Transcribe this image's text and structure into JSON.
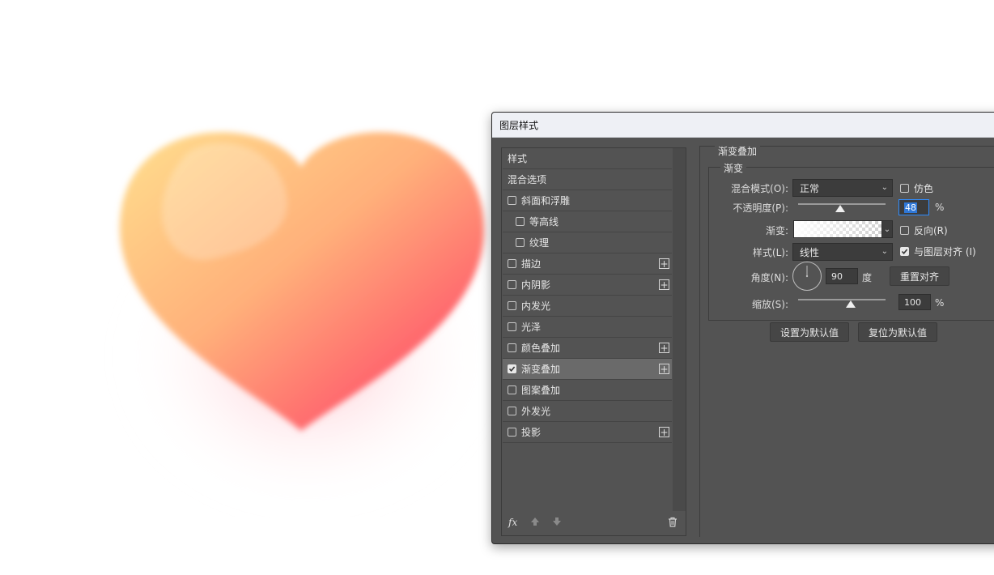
{
  "dialog": {
    "title": "图层样式"
  },
  "style_list": {
    "header_items": [
      {
        "label": "样式"
      },
      {
        "label": "混合选项"
      }
    ],
    "items": [
      {
        "label": "斜面和浮雕",
        "checked": false,
        "has_plus": false,
        "indent": false
      },
      {
        "label": "等高线",
        "checked": false,
        "has_plus": false,
        "indent": true
      },
      {
        "label": "纹理",
        "checked": false,
        "has_plus": false,
        "indent": true
      },
      {
        "label": "描边",
        "checked": false,
        "has_plus": true,
        "indent": false
      },
      {
        "label": "内阴影",
        "checked": false,
        "has_plus": true,
        "indent": false
      },
      {
        "label": "内发光",
        "checked": false,
        "has_plus": false,
        "indent": false
      },
      {
        "label": "光泽",
        "checked": false,
        "has_plus": false,
        "indent": false
      },
      {
        "label": "颜色叠加",
        "checked": false,
        "has_plus": true,
        "indent": false
      },
      {
        "label": "渐变叠加",
        "checked": true,
        "has_plus": true,
        "indent": false,
        "selected": true
      },
      {
        "label": "图案叠加",
        "checked": false,
        "has_plus": false,
        "indent": false
      },
      {
        "label": "外发光",
        "checked": false,
        "has_plus": false,
        "indent": false
      },
      {
        "label": "投影",
        "checked": false,
        "has_plus": true,
        "indent": false
      }
    ],
    "footer": {
      "fx": "fx",
      "up_icon": "arrow-up-icon",
      "down_icon": "arrow-down-icon",
      "trash_icon": "trash-icon"
    }
  },
  "gradient_overlay": {
    "section_title": "渐变叠加",
    "group_title": "渐变",
    "blend_mode_label": "混合模式(O):",
    "blend_mode_value": "正常",
    "dither_label": "仿色",
    "dither_checked": false,
    "opacity_label": "不透明度(P):",
    "opacity_value": "48",
    "opacity_unit": "%",
    "opacity_fraction": 0.48,
    "gradient_label": "渐变:",
    "reverse_label": "反向(R)",
    "reverse_checked": false,
    "style_label": "样式(L):",
    "style_value": "线性",
    "align_label": "与图层对齐 (I)",
    "align_checked": true,
    "angle_label": "角度(N):",
    "angle_value": "90",
    "angle_unit": "度",
    "reset_align_button": "重置对齐",
    "scale_label": "缩放(S):",
    "scale_value": "100",
    "scale_unit": "%",
    "scale_fraction": 0.6,
    "set_default_button": "设置为默认值",
    "reset_default_button": "复位为默认值"
  },
  "colors": {
    "dialog_bg": "#535353",
    "titlebar_bg": "#eef0f5",
    "heart_top": "#ffd38a",
    "heart_bottom": "#ff4d6b"
  }
}
